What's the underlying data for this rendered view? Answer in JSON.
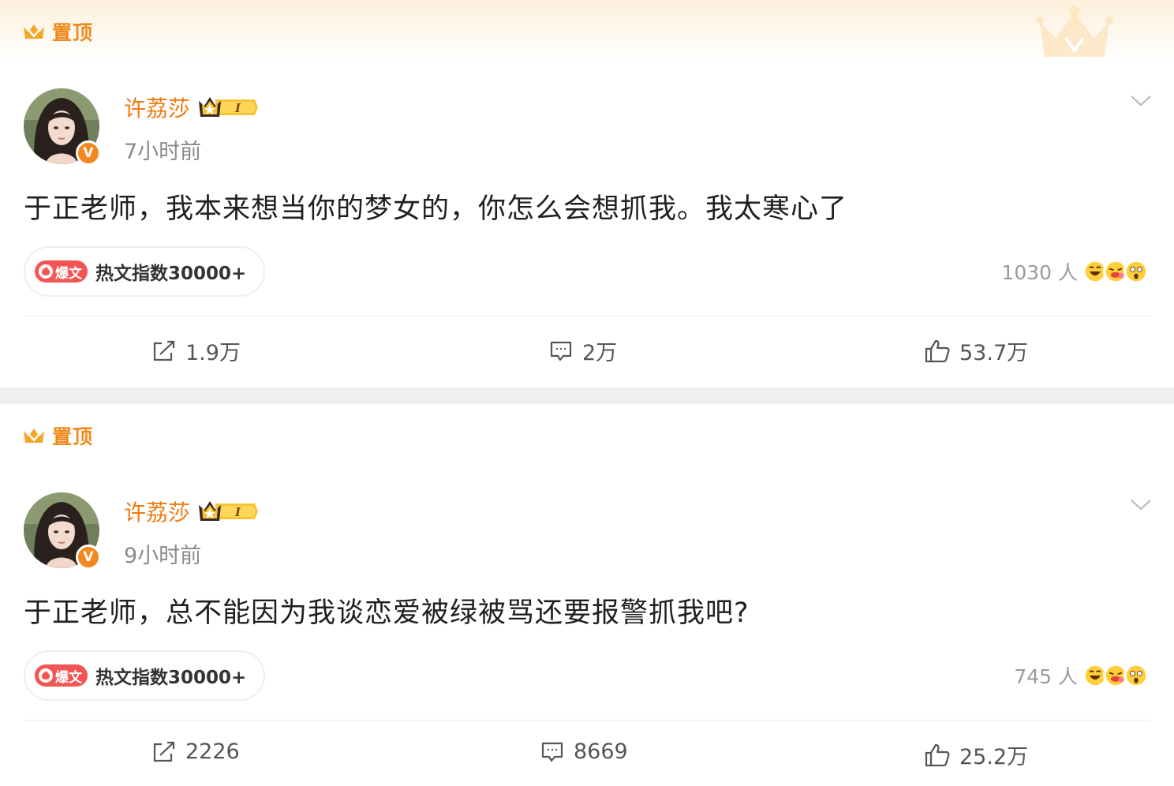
{
  "posts": [
    {
      "pin_label": "置顶",
      "user_name": "许荔莎",
      "time": "7小时前",
      "content": "于正老师，我本来想当你的梦女的，你怎么会想抓我。我太寒心了",
      "hot_tag": "爆文",
      "hot_text": "热文指数30000+",
      "reaction_count": "1030 人",
      "repost": "1.9万",
      "comment": "2万",
      "like": "53.7万",
      "verified_badge": "V",
      "vip_level": "I"
    },
    {
      "pin_label": "置顶",
      "user_name": "许荔莎",
      "time": "9小时前",
      "content": "于正老师，总不能因为我谈恋爱被绿被骂还要报警抓我吧?",
      "hot_tag": "爆文",
      "hot_text": "热文指数30000+",
      "reaction_count": "745 人",
      "repost": "2226",
      "comment": "8669",
      "like": "25.2万",
      "verified_badge": "V",
      "vip_level": "I"
    }
  ],
  "colors": {
    "accent_orange": "#f07a12",
    "pin_orange": "#f08a1c",
    "hot_red": "#f35454",
    "separator": "#efefef"
  },
  "icons": [
    "crown-icon",
    "vip-crown-icon",
    "chevron-down-icon",
    "repost-icon",
    "comment-icon",
    "like-icon",
    "verified-v-icon",
    "flame-icon"
  ]
}
